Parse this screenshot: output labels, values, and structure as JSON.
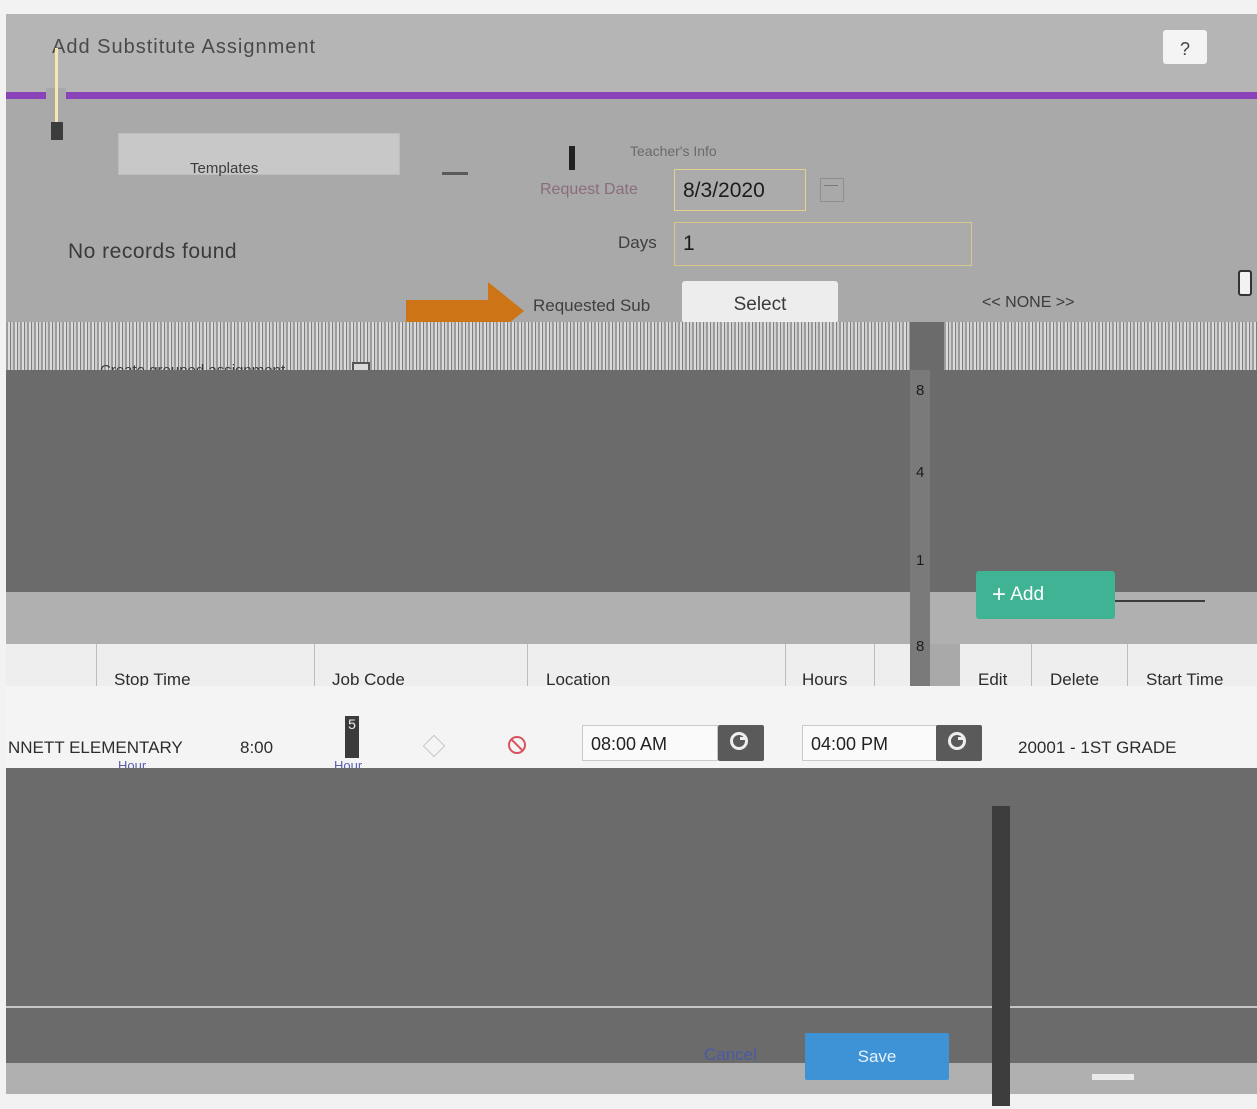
{
  "dialog": {
    "title": "Add Substitute Assignment",
    "help_label": "?"
  },
  "templates": {
    "label": "Templates",
    "empty_text": "No records found"
  },
  "form": {
    "section_header": "Teacher's Info",
    "request_date_label": "Request Date",
    "request_date_value": "8/3/2020",
    "days_label": "Days",
    "days_value": "1",
    "requested_sub_label": "Requested Sub",
    "select_button": "Select",
    "requested_sub_value": "<< NONE >>"
  },
  "grouped": {
    "label": "Create grouped assignment"
  },
  "side_numbers": [
    "8",
    "4",
    "1",
    "8"
  ],
  "add_button": "Add",
  "table": {
    "headers": [
      "Stop Time",
      "Job Code",
      "Location",
      "Hours",
      "Edit",
      "Delete",
      "Start Time"
    ],
    "row": {
      "location_left": "NNETT ELEMENTARY",
      "stop_time": "8:00",
      "marker": "5",
      "start_time": "08:00 AM",
      "stop_time_input": "04:00 PM",
      "job_code": "20001 - 1ST GRADE"
    },
    "links": [
      "Hour",
      "Hour"
    ]
  },
  "footer": {
    "cancel_label": "Cancel",
    "save_label": "Save"
  },
  "colors": {
    "accent_purple": "#8a42b8",
    "add_green": "#3fb393",
    "save_blue": "#3d93d6",
    "arrow_orange": "#cc7416",
    "arrow_blue": "#4b8ba6"
  }
}
